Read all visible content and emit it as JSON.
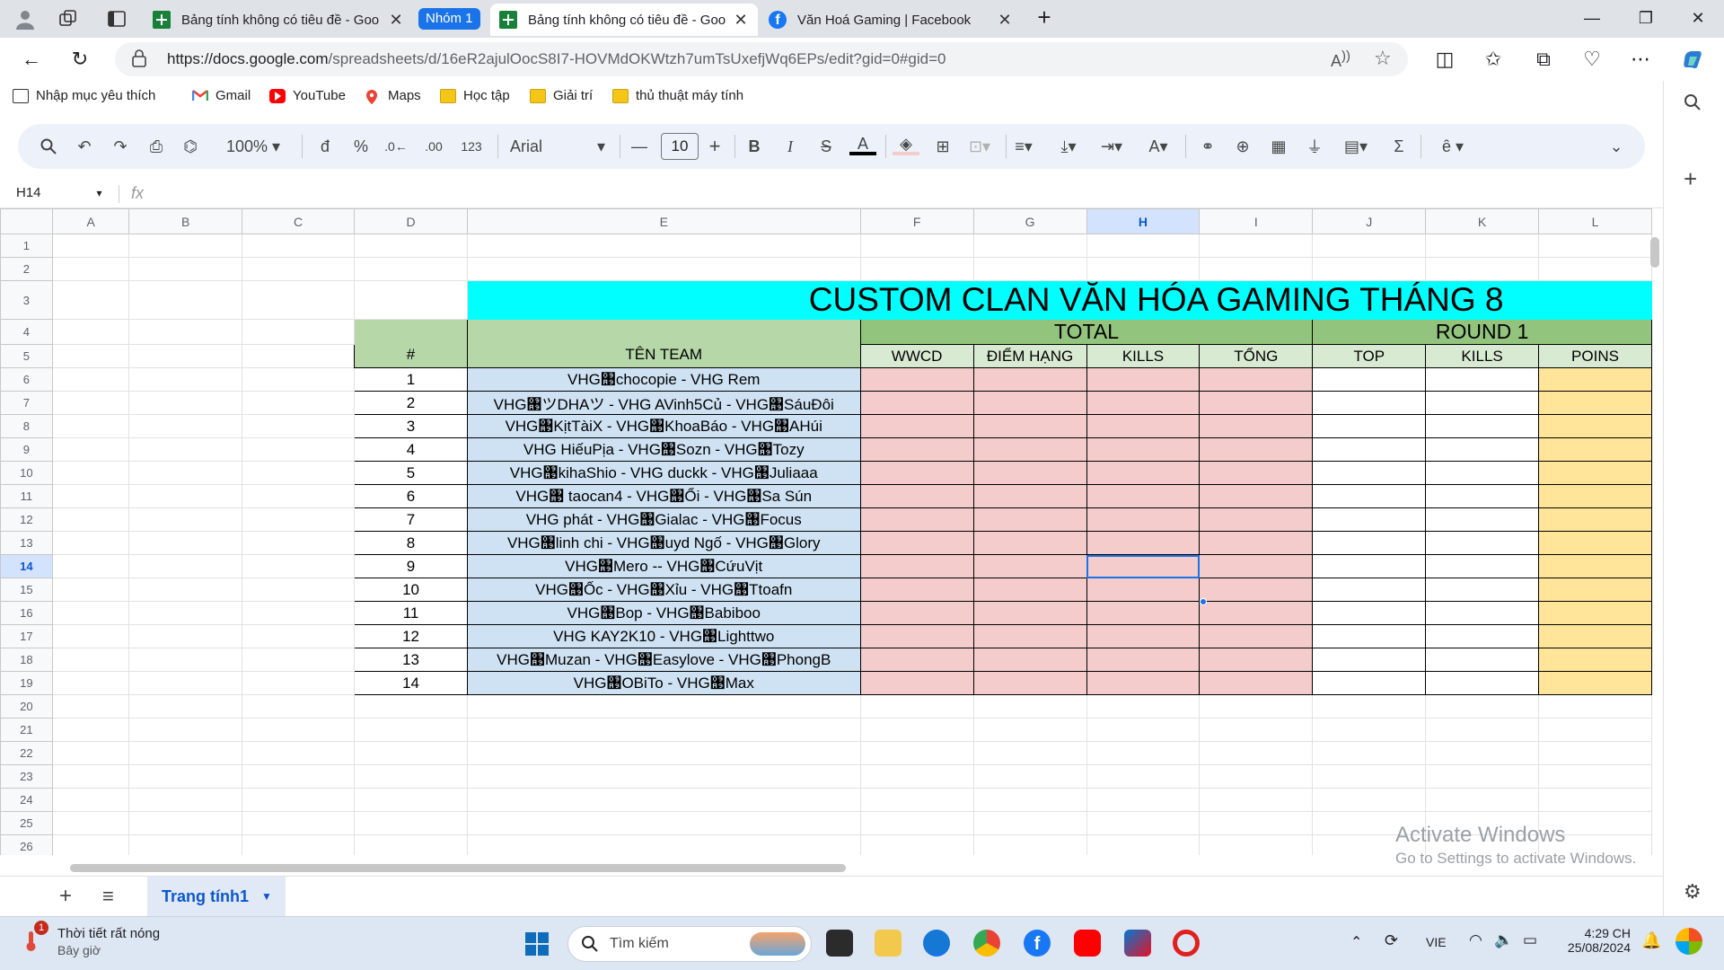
{
  "browser": {
    "tabs": [
      {
        "title": "Bảng tính không có tiêu đề - Goo",
        "active": false,
        "icon": "sheets-icon"
      },
      {
        "title": "Bảng tính không có tiêu đề - Goo",
        "active": true,
        "icon": "sheets-icon"
      },
      {
        "title": "Văn Hoá Gaming | Facebook",
        "active": false,
        "icon": "facebook-icon"
      }
    ],
    "group_label": "Nhóm 1",
    "url_host": "https://docs.google.com",
    "url_path": "/spreadsheets/d/16eR2ajulOocS8I7-HOVMdOKWtzh7umTsUxefjWq6EPs/edit?gid=0#gid=0",
    "bookmarks": [
      "Nhập mục yêu thích",
      "Gmail",
      "YouTube",
      "Maps",
      "Học tập",
      "Giải trí",
      "thủ thuật máy tính"
    ]
  },
  "toolbar": {
    "zoom": "100%",
    "currency": "đ",
    "percent": "%",
    "dec_less": ".0",
    "dec_more": ".00",
    "format_123": "123",
    "font": "Arial",
    "font_size": "10"
  },
  "formula_bar": {
    "name_box": "H14",
    "fx": "fx"
  },
  "grid": {
    "columns": [
      "A",
      "B",
      "C",
      "D",
      "E",
      "F",
      "G",
      "H",
      "I",
      "J",
      "K",
      "L"
    ],
    "selected_column": "H",
    "selected_row": 14,
    "title": "CUSTOM  CLAN VĂN HÓA GAMING THÁNG 8",
    "hash_header": "#",
    "team_header": "TÊN TEAM",
    "total_header": "TOTAL",
    "round_header": "ROUND 1",
    "total_sub": [
      "WWCD",
      "ĐIỂM HẠNG",
      "KILLS",
      "TỔNG"
    ],
    "round_sub": [
      "TOP",
      "KILLS",
      "POINS"
    ],
    "teams": [
      {
        "n": "1",
        "name": "VHG঩chocopie  -  VHG Rem"
      },
      {
        "n": "2",
        "name": "VHG঩ツDHAツ  -   VHG AVinh5Củ   -  VHG঩SáuĐôi"
      },
      {
        "n": "3",
        "name": "VHG঩KịtTàiX  -   VHG঩KhoaBáo  -  VHG঩AHúi"
      },
      {
        "n": "4",
        "name": "VHG HiếuPịa   -  VHG঩Sozn  -  VHG঩Tozy"
      },
      {
        "n": "5",
        "name": "VHG঩kihaShio  -    VHG duckk   -  VHG঩Juliaaa"
      },
      {
        "n": "6",
        "name": "VHG঩ taocan4  -  VHG঩Ổi  -  VHG঩Sa Sún"
      },
      {
        "n": "7",
        "name": "VHG phát -  VHG঩Gialac  -   VHG঩Focus"
      },
      {
        "n": "8",
        "name": "VHG঩linh chi  -  VHG঩uyd   Ngố   -   VHG঩Glory"
      },
      {
        "n": "9",
        "name": "VHG঩Mero -- VHG঩CứuVịt"
      },
      {
        "n": "10",
        "name": "VHG঩Ốc  -  VHG঩Xỉu  -  VHG঩Ttoafn"
      },
      {
        "n": "11",
        "name": "VHG঩Bop  -   VHG঩Babiboo"
      },
      {
        "n": "12",
        "name": "VHG KAY2K10  -  VHG঩Lighttwo"
      },
      {
        "n": "13",
        "name": "VHG঩Muzan  -  VHG঩Easylove  -  VHG঩PhongB"
      },
      {
        "n": "14",
        "name": "VHG঩OBiTo  -  VHG঩Max"
      }
    ],
    "colors": {
      "title_bg": "#00ffff",
      "header_green": "#b6d7a8",
      "team_blue": "#cfe2f3",
      "total_pink": "#f4cccc",
      "points_gold": "#ffe599"
    }
  },
  "sheet_tabs": {
    "active": "Trang tính1"
  },
  "watermark": {
    "line1": "Activate Windows",
    "line2": "Go to Settings to activate Windows."
  },
  "taskbar": {
    "weather_title": "Thời tiết rất nóng",
    "weather_sub": "Bây giờ",
    "weather_badge": "1",
    "search_placeholder": "Tìm kiếm",
    "lang": "VIE",
    "time": "4:29 CH",
    "date": "25/08/2024"
  }
}
